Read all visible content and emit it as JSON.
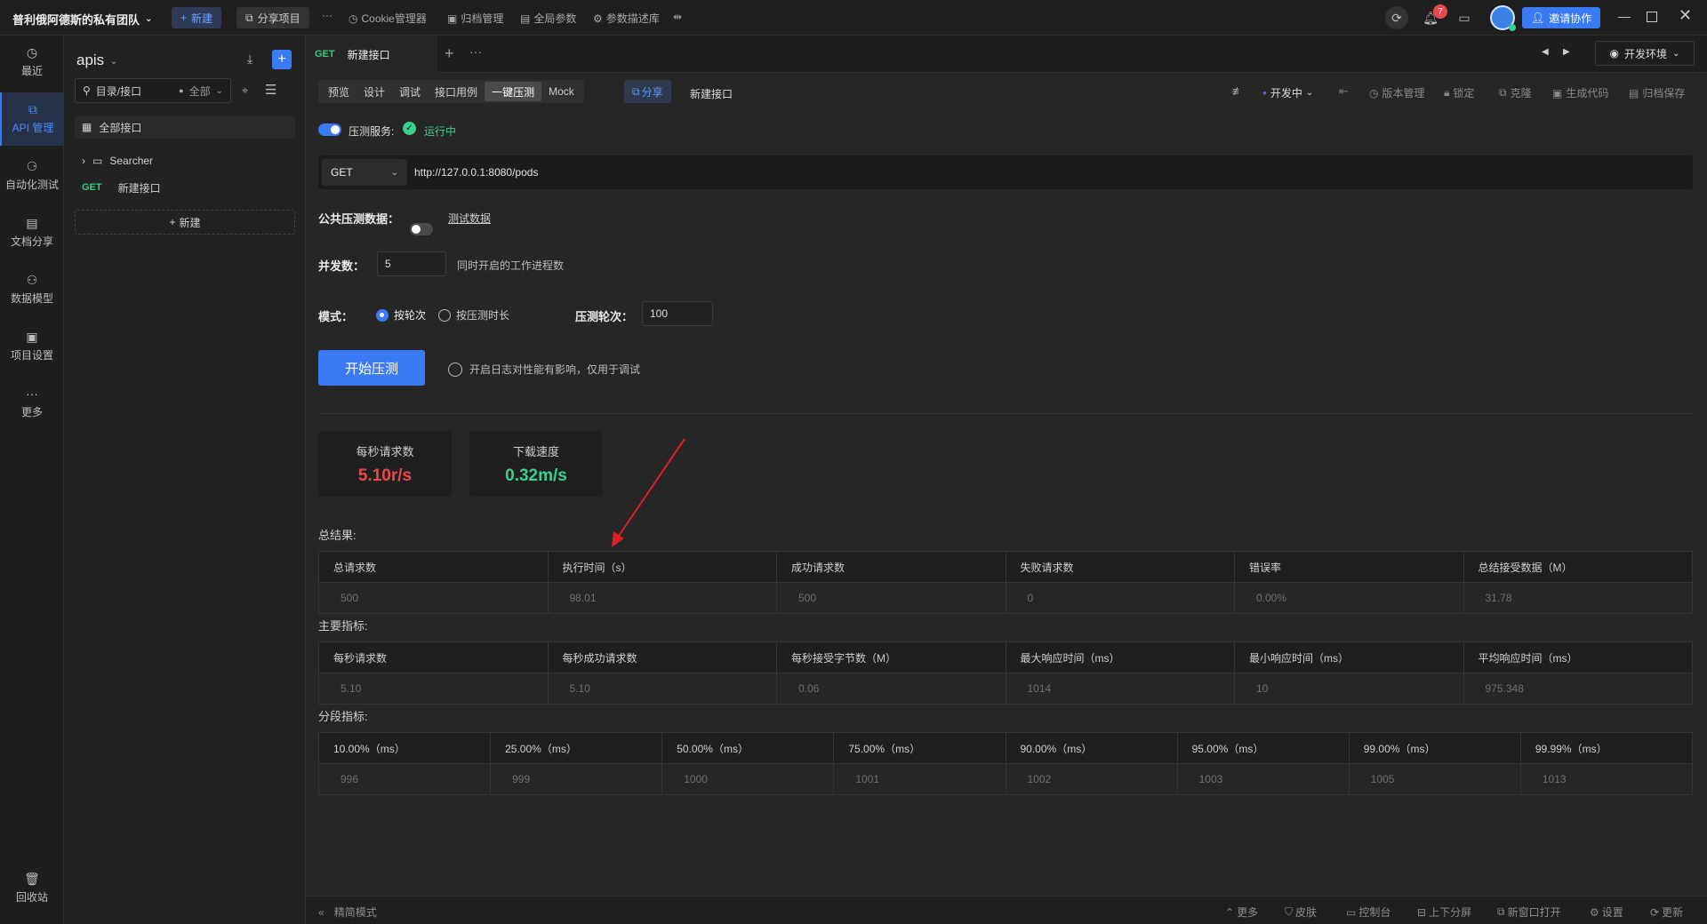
{
  "topbar": {
    "team_name": "普利俄阿德斯的私有团队",
    "new_label": "新建",
    "share_project_label": "分享项目",
    "links": [
      "Cookie管理器",
      "归档管理",
      "全局参数",
      "参数描述库"
    ],
    "notification_count": "7",
    "invite_label": "邀请协作"
  },
  "leftnav": {
    "items": [
      {
        "label": "最近",
        "icon": "clock-icon"
      },
      {
        "label": "API 管理",
        "icon": "api-icon"
      },
      {
        "label": "自动化测试",
        "icon": "automation-icon"
      },
      {
        "label": "文档分享",
        "icon": "document-icon"
      },
      {
        "label": "数据模型",
        "icon": "data-model-icon"
      },
      {
        "label": "项目设置",
        "icon": "settings-icon"
      },
      {
        "label": "更多",
        "icon": "more-icon"
      }
    ],
    "trash_label": "回收站"
  },
  "tree": {
    "title": "apis",
    "search_placeholder": "目录/接口",
    "filter_label": "全部",
    "all_label": "全部接口",
    "folder_label": "Searcher",
    "item_method": "GET",
    "item_label": "新建接口",
    "new_label": "新建"
  },
  "tabs": {
    "active_method": "GET",
    "active_label": "新建接口",
    "env_label": "开发环境"
  },
  "subtabs": [
    "预览",
    "设计",
    "调试",
    "接口用例",
    "一键压测",
    "Mock"
  ],
  "toolbar": {
    "share_label": "分享",
    "api_name": "新建接口",
    "status_label": "开发中",
    "tools": [
      "版本管理",
      "锁定",
      "克隆",
      "生成代码",
      "归档保存"
    ]
  },
  "stress": {
    "service_label": "压测服务:",
    "service_status": "运行中",
    "method": "GET",
    "url": "http://127.0.0.1:8080/pods",
    "public_data_label": "公共压测数据：",
    "test_data_link": "测试数据",
    "concurrency_label": "并发数：",
    "concurrency_value": "5",
    "concurrency_hint": "同时开启的工作进程数",
    "mode_label": "模式：",
    "mode_by_rounds": "按轮次",
    "mode_by_duration": "按压测时长",
    "rounds_label": "压测轮次：",
    "rounds_value": "100",
    "start_label": "开始压测",
    "log_hint": "开启日志对性能有影响，仅用于调试"
  },
  "stats": {
    "rps_label": "每秒请求数",
    "rps_value": "5.10r/s",
    "download_label": "下载速度",
    "download_value": "0.32m/s",
    "rps_color": "#e8484e",
    "download_color": "#3ad18f"
  },
  "summary": {
    "label": "总结果:",
    "headers": [
      "总请求数",
      "执行时间（s）",
      "成功请求数",
      "失败请求数",
      "错误率",
      "总结接受数据（M）"
    ],
    "values": [
      "500",
      "98.01",
      "500",
      "0",
      "0.00%",
      "31.78"
    ]
  },
  "metrics": {
    "label": "主要指标:",
    "headers": [
      "每秒请求数",
      "每秒成功请求数",
      "每秒接受字节数（M）",
      "最大响应时间（ms）",
      "最小响应时间（ms）",
      "平均响应时间（ms）"
    ],
    "values": [
      "5.10",
      "5.10",
      "0.06",
      "1014",
      "10",
      "975.348"
    ]
  },
  "percentiles": {
    "label": "分段指标:",
    "headers": [
      "10.00%（ms）",
      "25.00%（ms）",
      "50.00%（ms）",
      "75.00%（ms）",
      "90.00%（ms）",
      "95.00%（ms）",
      "99.00%（ms）",
      "99.99%（ms）"
    ],
    "values": [
      "996",
      "999",
      "1000",
      "1001",
      "1002",
      "1003",
      "1005",
      "1013"
    ]
  },
  "footer": {
    "simple_mode": "精简模式",
    "items": [
      "更多",
      "皮肤",
      "控制台",
      "上下分屏",
      "新窗口打开",
      "设置",
      "更新"
    ]
  },
  "colors": {
    "accent": "#3a7af5",
    "success": "#3ad18f",
    "get_method": "#38c980"
  }
}
